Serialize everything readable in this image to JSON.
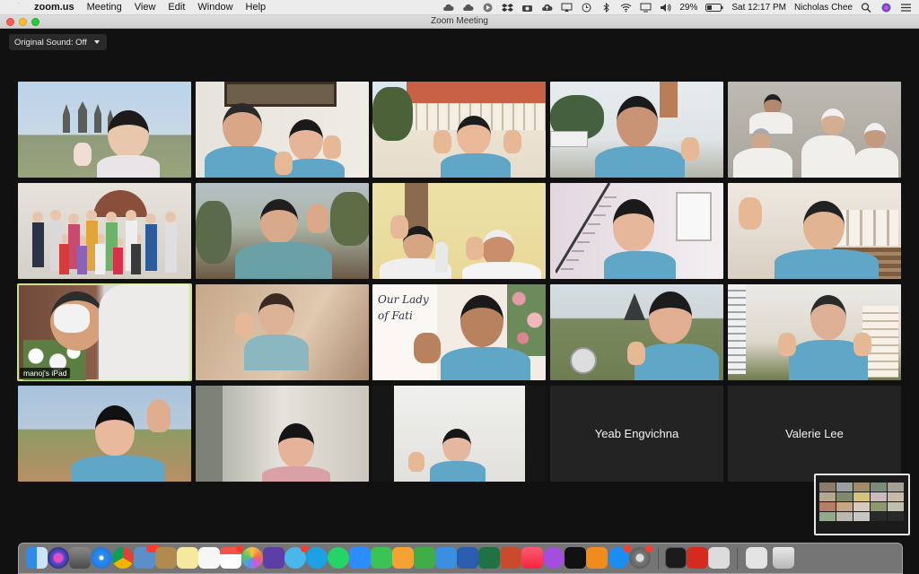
{
  "menubar": {
    "app_name": "zoom.us",
    "items": [
      "Meeting",
      "View",
      "Edit",
      "Window",
      "Help"
    ],
    "battery": "29%",
    "clock": "Sat 12:17 PM",
    "user": "Nicholas Chee",
    "status_icons": [
      "cloud-icon",
      "cloud-icon",
      "play-icon",
      "dropbox-icon",
      "camera-icon",
      "upload-icon",
      "airplay-icon",
      "clock-icon",
      "bluetooth-icon",
      "wifi-icon",
      "display-icon",
      "volume-icon",
      "battery-icon",
      "search-icon",
      "siri-icon",
      "list-icon"
    ]
  },
  "window": {
    "title": "Zoom Meeting"
  },
  "original_sound": {
    "label": "Original Sound: Off"
  },
  "participants": [
    {
      "scene": "temple",
      "label": ""
    },
    {
      "scene": "couple",
      "label": ""
    },
    {
      "scene": "building",
      "label": ""
    },
    {
      "scene": "village",
      "label": ""
    },
    {
      "scene": "group-sisters",
      "label": ""
    },
    {
      "scene": "church-group",
      "label": ""
    },
    {
      "scene": "forest",
      "label": ""
    },
    {
      "scene": "two-men",
      "label": ""
    },
    {
      "scene": "stairs",
      "label": ""
    },
    {
      "scene": "chapel",
      "label": ""
    },
    {
      "scene": "mask",
      "label": "manoj's iPad"
    },
    {
      "scene": "sepia",
      "label": ""
    },
    {
      "scene": "our-lady",
      "label": "",
      "backdrop_text": "Our Lady of Fati"
    },
    {
      "scene": "hills",
      "label": ""
    },
    {
      "scene": "tower",
      "label": ""
    },
    {
      "scene": "field",
      "label": ""
    },
    {
      "scene": "room",
      "label": ""
    },
    {
      "scene": "white-room",
      "label": ""
    },
    {
      "name": "Yeab Engvichna"
    },
    {
      "name": "Valerie Lee"
    }
  ],
  "active_speaker": "manoj's iPad",
  "dock": {
    "apps": [
      "finder-icon",
      "siri-icon",
      "launchpad-icon",
      "safari-icon",
      "chrome-icon",
      "preview-icon",
      "notes-app-icon",
      "stickies-icon",
      "reminders-icon",
      "calendar-icon",
      "photos-icon",
      "imovie-icon",
      "messages-icon",
      "skype-icon",
      "whatsapp-icon",
      "zoom-icon",
      "facetime-icon",
      "pages-icon",
      "numbers-icon",
      "keynote-icon",
      "word-icon",
      "excel-icon",
      "powerpoint-icon",
      "music-icon",
      "podcasts-icon",
      "tv-icon",
      "books-icon",
      "app-store-icon",
      "system-preferences-icon",
      "activity-monitor-icon",
      "acrobat-icon",
      "finder-window-icon",
      "downloads-icon",
      "trash-icon"
    ],
    "badges": {
      "photos-icon": "2,494",
      "calendar-icon": "9",
      "messages-icon": "1",
      "app-store-icon": "2",
      "system-preferences-icon": "1"
    }
  },
  "colors": {
    "accent_active": "#c9e48c",
    "tshirt": "#5fa6c7",
    "background": "#111111"
  }
}
